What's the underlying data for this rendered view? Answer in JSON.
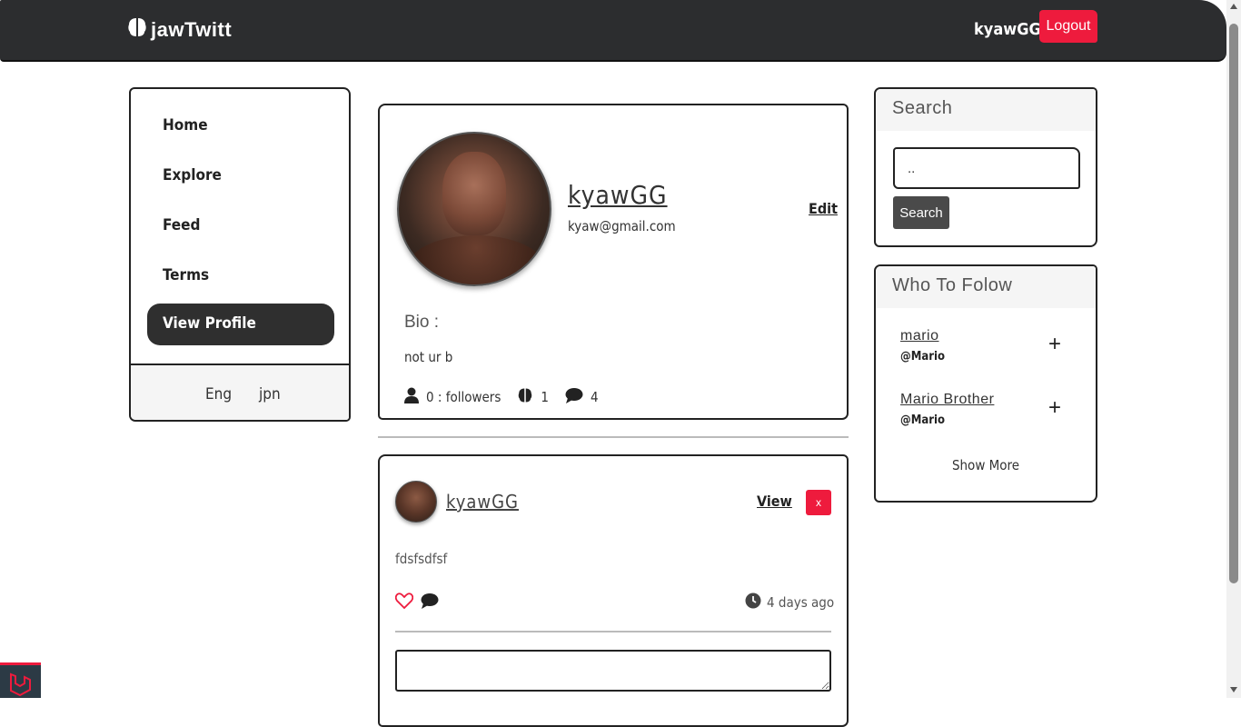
{
  "navbar": {
    "brand": "jawTwitt",
    "username": "kyawGG",
    "logout_label": "Logout"
  },
  "sidebar": {
    "items": [
      {
        "label": "Home"
      },
      {
        "label": "Explore"
      },
      {
        "label": "Feed"
      },
      {
        "label": "Terms"
      },
      {
        "label": "View Profile",
        "active": true
      }
    ],
    "languages": [
      "Eng",
      "jpn"
    ]
  },
  "profile": {
    "name": "kyawGG",
    "email": "kyaw@gmail.com",
    "edit_label": "Edit",
    "bio_label": "Bio :",
    "bio": "not ur b",
    "followers": "0 : followers",
    "ideas_count": "1",
    "comments_count": "4"
  },
  "post": {
    "username": "kyawGG",
    "view_label": "View",
    "delete_label": "x",
    "content": "fdsfsdfsf",
    "time": "4 days ago"
  },
  "search": {
    "title": "Search",
    "input_value": "..",
    "button_label": "Search"
  },
  "who_to_follow": {
    "title": "Who To Folow",
    "users": [
      {
        "name": "mario",
        "handle": "@Mario"
      },
      {
        "name": "Mario Brother",
        "handle": "@Mario"
      }
    ],
    "show_more": "Show More"
  },
  "colors": {
    "navbar_bg": "#2c2d2f",
    "accent_red": "#ee1b3d",
    "active_item_bg": "#2f2f2f",
    "search_button_bg": "#4a4a4a"
  }
}
